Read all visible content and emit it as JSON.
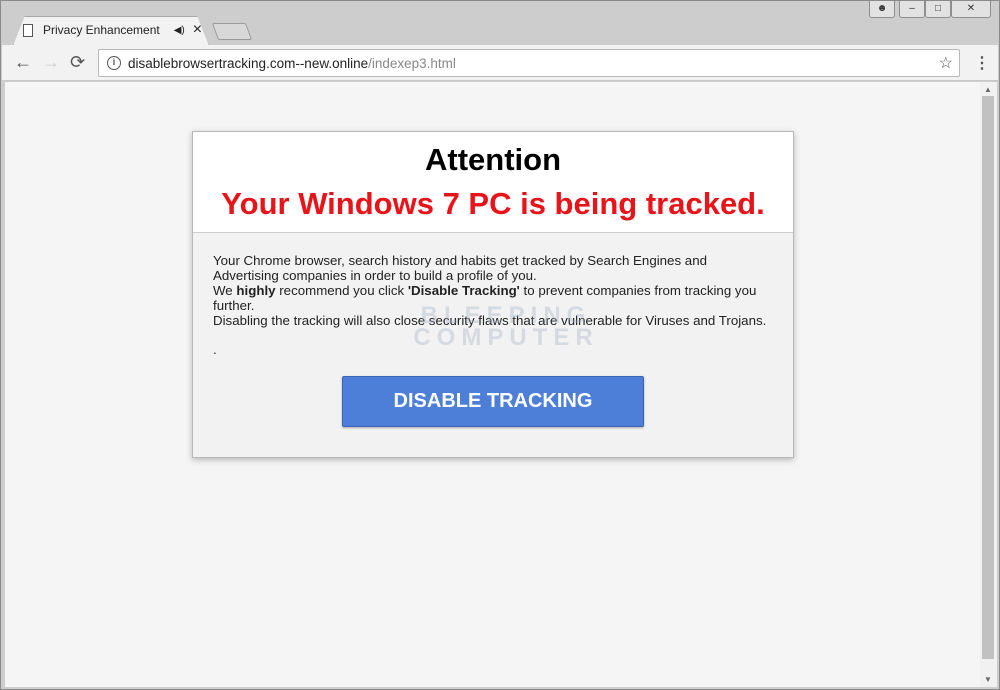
{
  "tab": {
    "title": "Privacy Enhancement",
    "file_icon": "page-icon",
    "audio_icon": "speaker-icon",
    "close_icon": "×"
  },
  "window": {
    "user": "user-icon",
    "minimize": "–",
    "maximize": "□",
    "close": "✕"
  },
  "toolbar": {
    "back": "←",
    "forward": "→",
    "reload": "⟳",
    "info": "i",
    "url_host": "disablebrowsertracking.com--new.online",
    "url_path": "/indexep3.html",
    "star": "☆",
    "menu": "⋮"
  },
  "dialog": {
    "heading": "Attention",
    "warning": "Your Windows 7 PC is being tracked.",
    "line1": "Your Chrome browser, search history and habits get tracked by Search Engines and Advertising companies in order to build a profile of you.",
    "line2_pre": "We ",
    "line2_bold1": "highly",
    "line2_mid": " recommend you click ",
    "line2_bold2": "'Disable Tracking'",
    "line2_post": " to prevent companies from tracking you further.",
    "line3": "Disabling the tracking will also close security flaws that are vulnerable for Viruses and Trojans.",
    "dot": ".",
    "button": "DISABLE TRACKING",
    "watermark": "BLEEPING COMPUTER"
  },
  "colors": {
    "warning": "#e8141a",
    "button": "#4d7fd9"
  }
}
